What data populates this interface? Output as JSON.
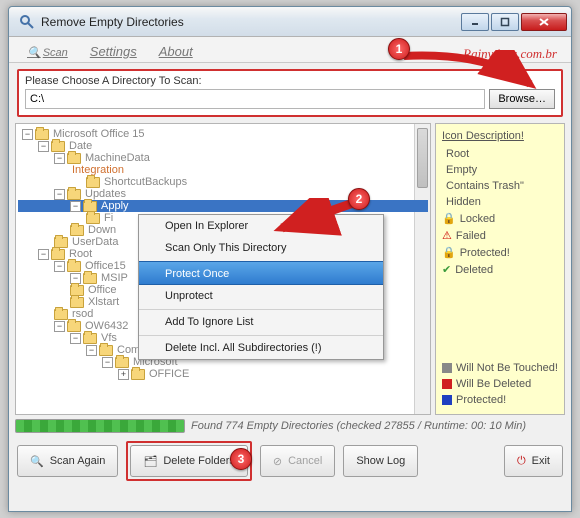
{
  "window": {
    "title": "Remove Empty Directories"
  },
  "tabs": {
    "scan": "Scan",
    "settings": "Settings",
    "about": "About"
  },
  "brand": "Rainvdavs.com.br",
  "path": {
    "label": "Please Choose A Directory To Scan:",
    "value": "C:\\",
    "browse": "Browse…"
  },
  "tree": {
    "n0": "Microsoft Office 15",
    "n1": "Date",
    "n2": "MachineData",
    "n3": "Integration",
    "n4": "ShortcutBackups",
    "n5": "Updates",
    "n6": "Apply",
    "n7": "Fi",
    "n8": "Down",
    "n9": "UserData",
    "n10": "Root",
    "n11": "Office15",
    "n12": "MSIP",
    "n13": "Office",
    "n14": "Xlstart",
    "n15": "rsod",
    "n16": "OW6432",
    "n17": "Vfs",
    "n18": "Common AppData",
    "n19": "Microsoft",
    "n20": "OFFICE"
  },
  "ctx": {
    "m0": "Open In Explorer",
    "m1": "Scan Only This Directory",
    "m2": "Protect Once",
    "m3": "Unprotect",
    "m4": "Add To Ignore List",
    "m5": "Delete Incl. All Subdirectories (!)"
  },
  "legend": {
    "title": "Icon Description!",
    "root": "Root",
    "empty": "Empty",
    "trash": "Contains Trash\"",
    "hidden": "Hidden",
    "locked": "Locked",
    "failed": "Failed",
    "protected": "Protected!",
    "deleted": "Deleted",
    "untouched": "Will Not Be Touched!",
    "willdel": "Will Be Deleted",
    "prot2": "Protected!"
  },
  "status": {
    "text": "Found 774 Empty Directories (checked 27855 / Runtime: 00: 10 Min)"
  },
  "buttons": {
    "scan": "Scan Again",
    "del": "Delete Folders",
    "cancel": "Cancel",
    "log": "Show Log",
    "exit": "Exit"
  },
  "badges": {
    "b1": "1",
    "b2": "2",
    "b3": "3"
  }
}
